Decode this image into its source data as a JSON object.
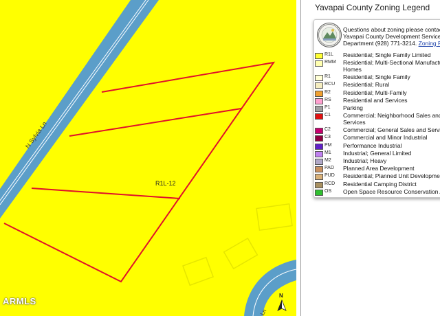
{
  "map": {
    "road_label_main": "N Sylvia Ln",
    "road_label_corner": "Ln",
    "parcel_zone_label": "R1L-12",
    "north_label": "N",
    "watermark": "ARMLS"
  },
  "legend": {
    "title": "Yavapai County Zoning Legend",
    "contact_lines": [
      "Questions about zoning please contact",
      "Yavapai County Development Services",
      "Department (928) 771-3214."
    ],
    "contact_link": "Zoning P",
    "items": [
      {
        "code": "R1L",
        "color": "#ffff33",
        "desc": [
          "Residential; Single Family Limited"
        ]
      },
      {
        "code": "RMM",
        "color": "#ffffb0",
        "desc": [
          "Residential; Multi-Sectional Manufactured",
          "Homes"
        ]
      },
      {
        "code": "R1",
        "color": "#ffffd6",
        "desc": [
          "Residential; Single Family"
        ]
      },
      {
        "code": "RCU",
        "color": "#f5edc0",
        "desc": [
          "Residential; Rural"
        ]
      },
      {
        "code": "R2",
        "color": "#f0a030",
        "desc": [
          "Residential; Multi-Family"
        ]
      },
      {
        "code": "RS",
        "color": "#ffa0d0",
        "desc": [
          "Residential and Services"
        ]
      },
      {
        "code": "P1",
        "color": "#a0a0a0",
        "desc": [
          "Parking"
        ]
      },
      {
        "code": "C1",
        "color": "#e01010",
        "desc": [
          "Commercial; Neighborhood Sales and",
          "Services"
        ]
      },
      {
        "code": "C2",
        "color": "#c8006e",
        "desc": [
          "Commercial; General Sales and Services"
        ]
      },
      {
        "code": "C3",
        "color": "#900040",
        "desc": [
          "Commercial and Minor Industrial"
        ]
      },
      {
        "code": "PM",
        "color": "#6020c8",
        "desc": [
          "Performance Industrial"
        ]
      },
      {
        "code": "M1",
        "color": "#c080f0",
        "desc": [
          "Industrial; General Limited"
        ]
      },
      {
        "code": "M2",
        "color": "#b0a8c8",
        "desc": [
          "Industrial; Heavy"
        ]
      },
      {
        "code": "PAD",
        "color": "#c89060",
        "desc": [
          "Planned Area Development"
        ]
      },
      {
        "code": "PUD",
        "color": "#d8b078",
        "desc": [
          "Residential; Planned Unit Development"
        ]
      },
      {
        "code": "RCD",
        "color": "#a89060",
        "desc": [
          "Residential Camping District"
        ]
      },
      {
        "code": "OS",
        "color": "#30c030",
        "desc": [
          "Open Space Resource Conservation Area"
        ]
      }
    ]
  },
  "colors": {
    "zone_yellow": "#ffff00",
    "road_blue": "#5b9ec9",
    "parcel_line": "#e0102a"
  }
}
